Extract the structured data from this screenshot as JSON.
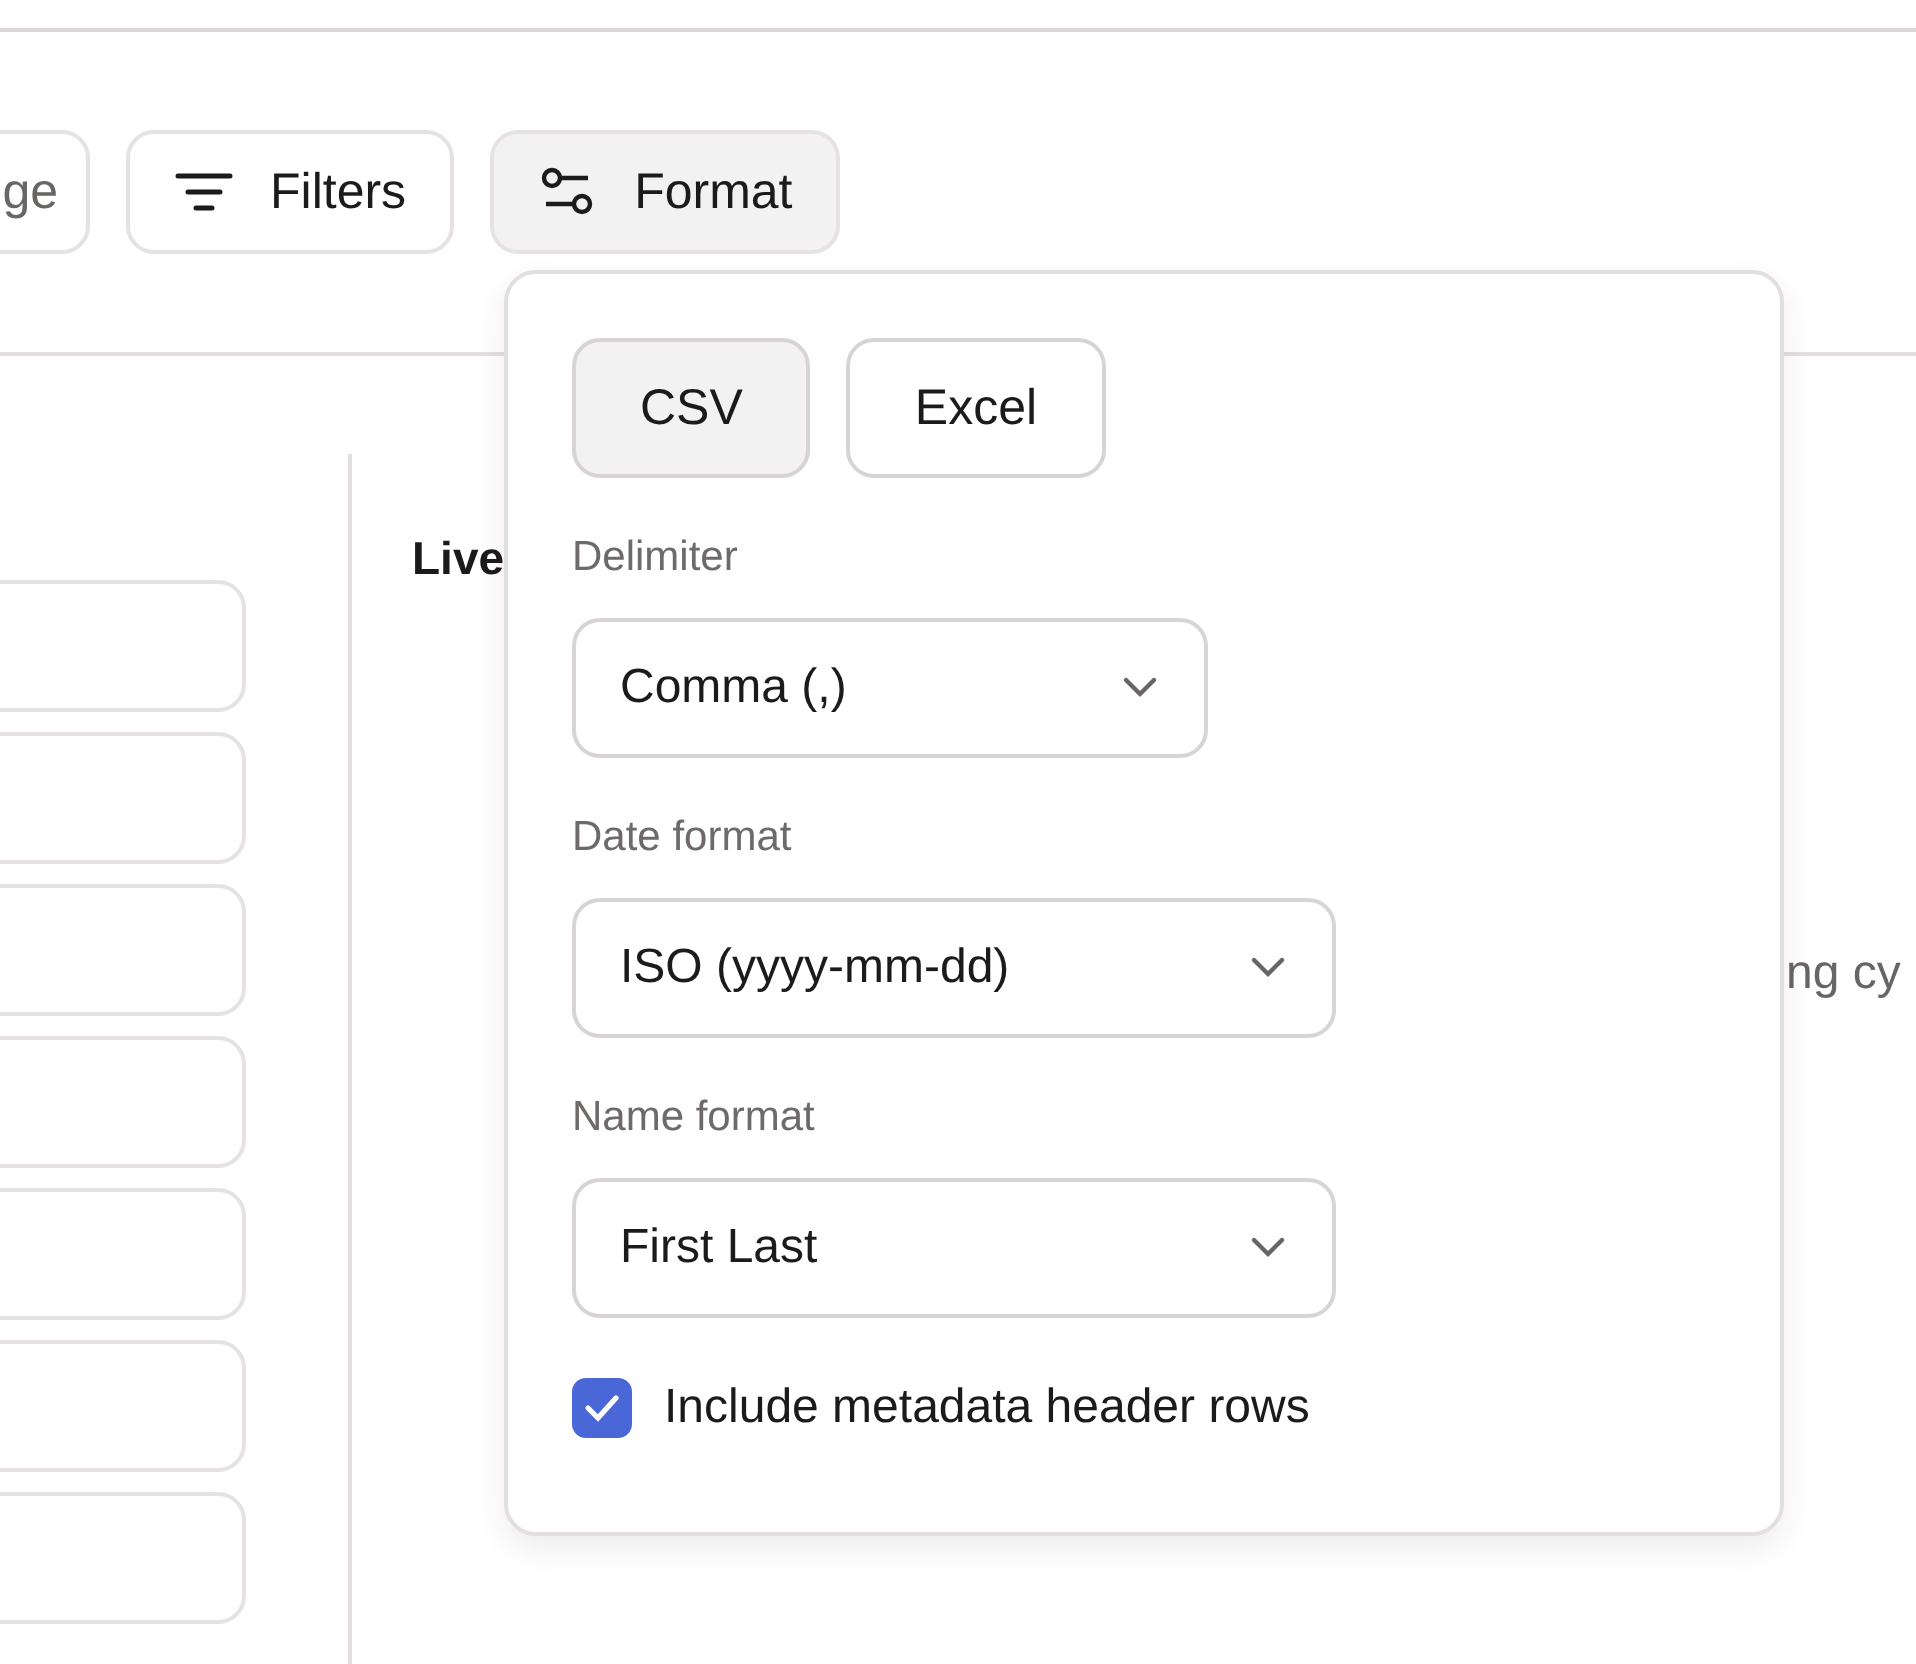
{
  "toolbar": {
    "buttons": [
      {
        "label": "ge",
        "expanded": false
      },
      {
        "label": "Filters",
        "expanded": false
      },
      {
        "label": "Format",
        "expanded": true
      }
    ]
  },
  "content": {
    "heading": "Live",
    "text_fragment": "ng cy"
  },
  "format_popover": {
    "formats": [
      {
        "label": "CSV",
        "selected": true
      },
      {
        "label": "Excel",
        "selected": false
      }
    ],
    "fields": [
      {
        "label": "Delimiter",
        "value": "Comma (,)"
      },
      {
        "label": "Date format",
        "value": "ISO (yyyy-mm-dd)"
      },
      {
        "label": "Name format",
        "value": "First Last"
      }
    ],
    "checkbox": {
      "label": "Include metadata header rows",
      "checked": true
    }
  }
}
